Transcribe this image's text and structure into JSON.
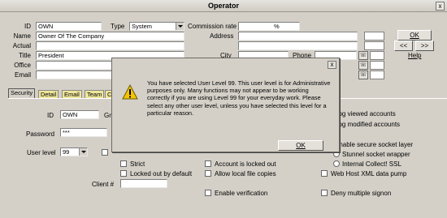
{
  "window": {
    "title": "Operator",
    "close_glyph": "x"
  },
  "form": {
    "id_label": "ID",
    "id_value": "OWN",
    "type_label": "Type",
    "type_value": "System",
    "commission_label": "Commission rate",
    "commission_unit": "%",
    "name_label": "Name",
    "name_value": "Owner Of The Company",
    "address_label": "Address",
    "actual_label": "Actual",
    "title_label": "Title",
    "title_value": "President",
    "city_label": "City",
    "phone_label": "Phone",
    "office_label": "Office",
    "email_label": "Email"
  },
  "buttons": {
    "ok": "OK",
    "prev": "<<",
    "next": ">>",
    "help": "Help"
  },
  "tabs": [
    "Security",
    "Detail",
    "Email",
    "Team",
    "C"
  ],
  "security": {
    "id_label": "ID",
    "id_value": "OWN",
    "group_label_partial": "Gr",
    "password_label": "Password",
    "password_value": "***",
    "userlevel_label": "User level",
    "userlevel_value": "99",
    "log_viewed": "Log viewed accounts",
    "log_modified": "Log modified accounts",
    "enable_ssl": "Enable secure socket layer",
    "stunnel": "Stunnel socket wrapper",
    "internal_ssl": "Internal Collect! SSL",
    "strict": "Strict",
    "locked_default": "Locked out by default",
    "client_label": "Client #",
    "account_locked": "Account is locked out",
    "allow_local": "Allow local file copies",
    "enable_verification": "Enable verification",
    "webhost_xml": "Web Host XML data pump",
    "deny_signon": "Deny multiple signon"
  },
  "dialog": {
    "close_glyph": "x",
    "icon": "warning-icon",
    "message": "You have selected User Level 99. This user level is for Administrative purposes only. Many functions may not appear to be working correctly if you are using Level 99 for your everyday work. Please select any other user level, unless you have selected this level for a particular reason.",
    "ok": "OK"
  },
  "colors": {
    "tab_inactive": "#efe69a",
    "dialog_face": "#d4d0c8",
    "window_face": "#d4d0c8"
  }
}
